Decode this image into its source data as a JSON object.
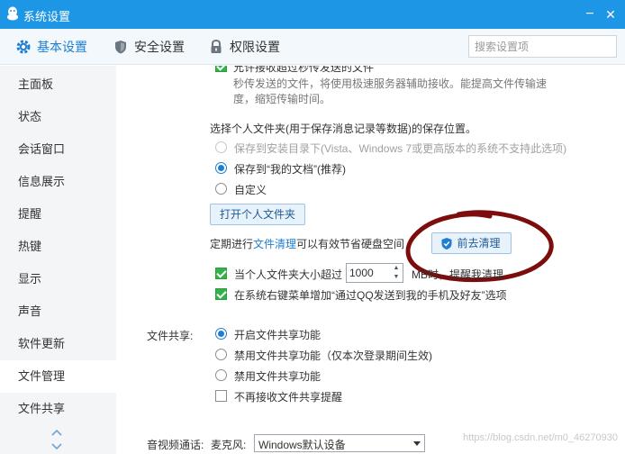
{
  "window": {
    "title": "系统设置",
    "minimize_glyph": "−",
    "close_glyph": "✕",
    "accent": "#1e96e6",
    "annotation_color": "#7d0c0c"
  },
  "tabs": [
    {
      "label": "基本设置",
      "icon": "gear-icon",
      "active": true
    },
    {
      "label": "安全设置",
      "icon": "shield-icon",
      "active": false
    },
    {
      "label": "权限设置",
      "icon": "lock-icon",
      "active": false
    }
  ],
  "search": {
    "placeholder": "搜索设置项"
  },
  "sidebar": {
    "items": [
      {
        "label": "主面板"
      },
      {
        "label": "状态"
      },
      {
        "label": "会话窗口"
      },
      {
        "label": "信息展示"
      },
      {
        "label": "提醒"
      },
      {
        "label": "热键"
      },
      {
        "label": "显示"
      },
      {
        "label": "声音"
      },
      {
        "label": "软件更新"
      },
      {
        "label": "文件管理",
        "active": true
      },
      {
        "label": "文件共享"
      }
    ]
  },
  "file_mgmt": {
    "fast_transfer_label": "允许接收超过秒传发送的文件",
    "fast_transfer_hint_line1": "秒传发送的文件，将使用极速服务器辅助接收。能提高文件传输速",
    "fast_transfer_hint_line2": "度，缩短传输时间。",
    "folder_prompt": "选择个人文件夹(用于保存消息记录等数据)的保存位置。",
    "options": [
      {
        "label": "保存到安装目录下(Vista、Windows 7或更高版本的系统不支持此选项)",
        "disabled": true,
        "checked": false
      },
      {
        "label": "保存到“我的文档”(推荐)",
        "checked": true
      },
      {
        "label": "自定义",
        "checked": false
      }
    ],
    "open_folder_button": "打开个人文件夹",
    "cleanup_text_before": "定期进行",
    "cleanup_link": "文件清理",
    "cleanup_text_after": "可以有效节省硬盘空间",
    "cleanup_button": "前去清理",
    "size_alert_prefix": "当个人文件夹大小超过",
    "size_value": "1000",
    "size_alert_suffix": "MB时，提醒我清理",
    "size_alert_checked": true,
    "context_menu_label": "在系统右键菜单增加“通过QQ发送到我的手机及好友”选项",
    "context_menu_checked": true
  },
  "file_share": {
    "label": "文件共享:",
    "options": [
      {
        "label": "开启文件共享功能",
        "checked": true
      },
      {
        "label": "禁用文件共享功能（仅本次登录期间生效)",
        "checked": false
      },
      {
        "label": "禁用文件共享功能",
        "checked": false
      }
    ],
    "no_notify_label": "不再接收文件共享提醒",
    "no_notify_checked": false
  },
  "av_call": {
    "label": "音视频通话:",
    "mic_label": "麦克风:",
    "mic_value": "Windows默认设备"
  },
  "watermark": "https://blog.csdn.net/m0_46270930"
}
